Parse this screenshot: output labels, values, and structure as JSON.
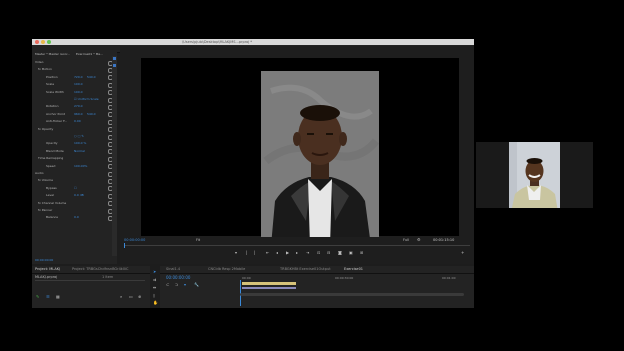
{
  "window": {
    "title": "\\Users\\pjulo\\Desktop\\MLAKJMS...prproj *"
  },
  "effect_controls": {
    "tabs": [
      "Effect Controls",
      "Workspaces",
      "Audio"
    ],
    "master": "Master * Master recor...",
    "clip": "Exercise01 * Ma...",
    "rows": [
      {
        "label": "Video",
        "v1": "",
        "v2": ""
      },
      {
        "label": "fx  Motion",
        "v1": "",
        "v2": ""
      },
      {
        "label": "Position",
        "v1": "720.0",
        "v2": "540.0"
      },
      {
        "label": "Scale",
        "v1": "100.0",
        "v2": ""
      },
      {
        "label": "Scale Width",
        "v1": "100.0",
        "v2": ""
      },
      {
        "label": "",
        "v1": "☑ Uniform Scale",
        "v2": ""
      },
      {
        "label": "Rotation",
        "v1": "270.0",
        "v2": ""
      },
      {
        "label": "Anchor Point",
        "v1": "960.0",
        "v2": "540.0"
      },
      {
        "label": "Anti-flicker F...",
        "v1": "0.00",
        "v2": ""
      },
      {
        "label": "fx  Opacity",
        "v1": "",
        "v2": ""
      },
      {
        "label": "",
        "v1": "○ □ ✎",
        "v2": ""
      },
      {
        "label": "Opacity",
        "v1": "100.0 %",
        "v2": ""
      },
      {
        "label": "Blend Mode",
        "v1": "Normal",
        "v2": ""
      },
      {
        "label": "Time Remapping",
        "v1": "",
        "v2": ""
      },
      {
        "label": "Speed",
        "v1": "100.00%",
        "v2": ""
      },
      {
        "label": "Audio",
        "v1": "",
        "v2": ""
      },
      {
        "label": "fx  Volume",
        "v1": "",
        "v2": ""
      },
      {
        "label": "Bypass",
        "v1": "☐",
        "v2": ""
      },
      {
        "label": "Level",
        "v1": "0.0 dB",
        "v2": ""
      },
      {
        "label": "fx  Channel Volume",
        "v1": "",
        "v2": ""
      },
      {
        "label": "fx  Panner",
        "v1": "",
        "v2": ""
      },
      {
        "label": "Balance",
        "v1": "0.0",
        "v2": ""
      }
    ],
    "timecode": "00:00:00:00"
  },
  "program_monitor": {
    "tab": "Program: Exercise01",
    "timecode_in": "00:00:00:00",
    "fit": "Fit",
    "quality": "Full",
    "timecode_out": "00:01:15:10"
  },
  "project": {
    "tabs": [
      "Project: MLAKJ",
      "Project: TRBGsChdfnsnBGr4k0iC"
    ],
    "item": "MLAKJ.prproj",
    "count": "1 Item"
  },
  "timeline": {
    "tabs": [
      "Sinal1.4",
      "CNCldb Resp 2Mobile",
      "TRBGKHBt Exercise01Output",
      "Exercise01"
    ],
    "timecode": "00:00:00:00",
    "ruler": [
      "00:00",
      "00:00:30:00",
      "00:01:00"
    ]
  },
  "colors": {
    "accent": "#3b8ad9",
    "panel": "#232323",
    "background": "#000000"
  }
}
